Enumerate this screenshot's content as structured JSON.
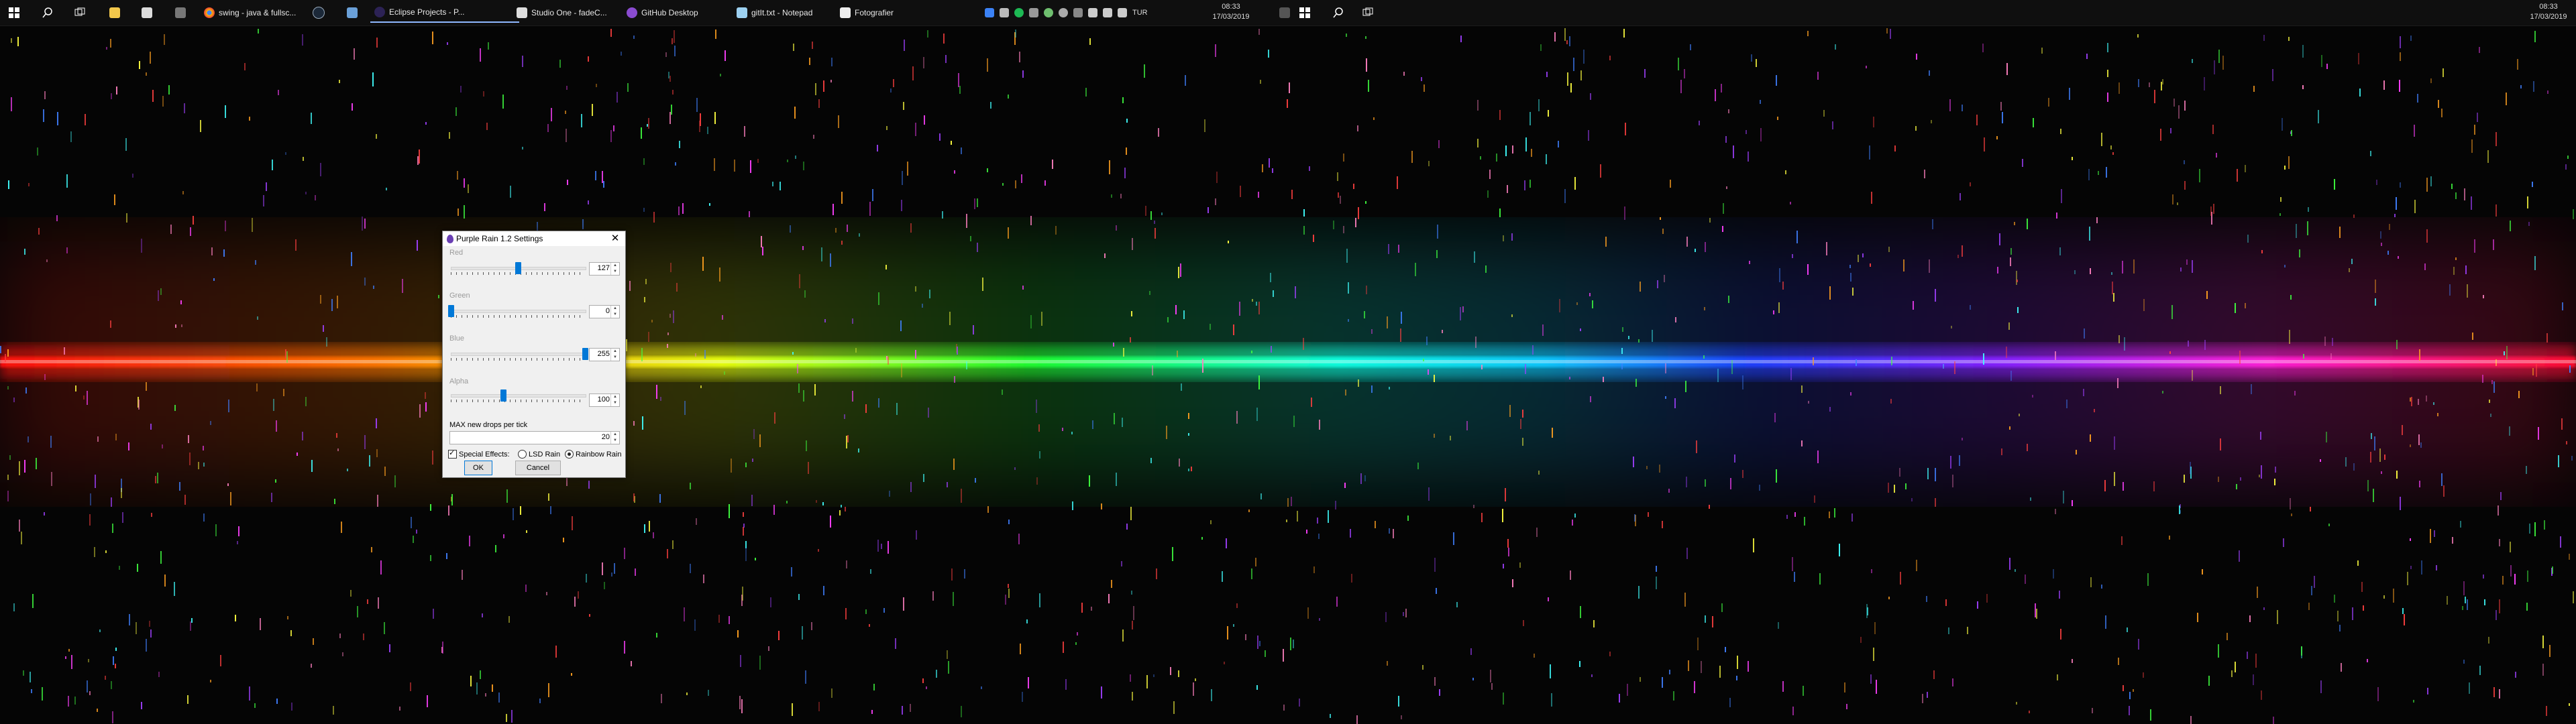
{
  "taskbar": {
    "apps": [
      {
        "label": "swing - java & fullsc..."
      },
      {
        "label": "Eclipse Projects - P..."
      },
      {
        "label": "Studio One - fadeC..."
      },
      {
        "label": "GitHub Desktop"
      },
      {
        "label": "gitIt.txt - Notepad"
      },
      {
        "label": "Fotografier"
      }
    ],
    "clock_left": {
      "time": "08:33",
      "date": "17/03/2019"
    },
    "language": "TUR",
    "clock_right": {
      "time": "08:33",
      "date": "17/03/2019"
    }
  },
  "dialog": {
    "title": "Purple Rain 1.2 Settings",
    "sliders": [
      {
        "label": "Red",
        "value": "127",
        "level": 0.5
      },
      {
        "label": "Green",
        "value": "0",
        "level": 0.0
      },
      {
        "label": "Blue",
        "value": "255",
        "level": 1.0
      },
      {
        "label": "Alpha",
        "value": "100",
        "level": 0.39
      }
    ],
    "max_drops_label": "MAX new drops per tick",
    "max_drops_value": "20",
    "special_effects_label": "Special Effects:",
    "special_effects_checked": true,
    "lsd_rain_label": "LSD Rain",
    "rainbow_rain_label": "Rainbow Rain",
    "rainbow_rain_selected": true,
    "ok_label": "OK",
    "cancel_label": "Cancel"
  },
  "colors": {
    "accent": "#0078d7",
    "drop_colors": [
      "#ff4040",
      "#ffa020",
      "#ffff40",
      "#40ff40",
      "#40ffff",
      "#4080ff",
      "#a040ff",
      "#ff40ff",
      "#ff80c0"
    ]
  }
}
